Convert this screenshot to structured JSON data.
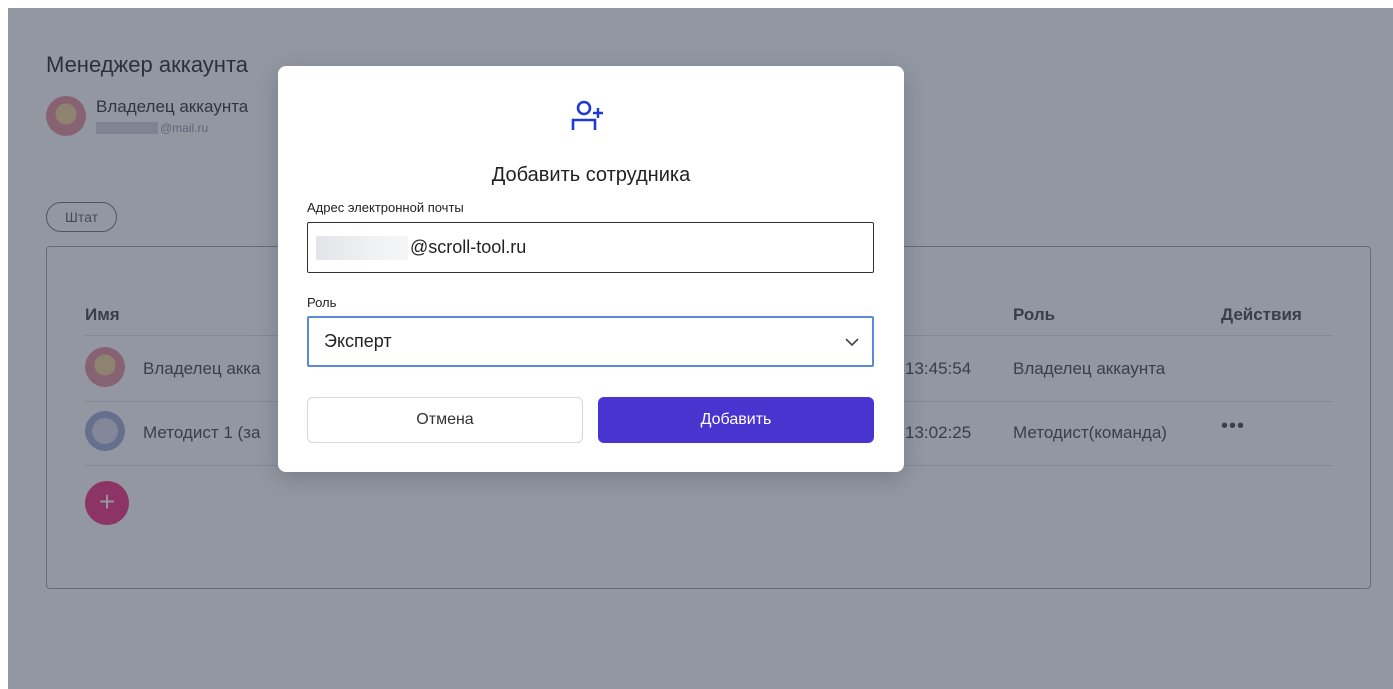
{
  "page": {
    "title": "Менеджер аккаунта",
    "owner_name": "Владелец аккаунта",
    "owner_email_suffix": "@mail.ru"
  },
  "staff_tab": {
    "label": "Штат"
  },
  "table": {
    "headers": {
      "name": "Имя",
      "role": "Роль",
      "actions": "Действия"
    },
    "rows": [
      {
        "name": "Владелец акка",
        "time": "13:45:54",
        "role": "Владелец аккаунта",
        "actions": ""
      },
      {
        "name": "Методист 1 (за",
        "time": "13:02:25",
        "role": "Методист(команда)",
        "actions": "•••"
      }
    ],
    "add_button": "+"
  },
  "modal": {
    "icon": "add-user-icon",
    "title": "Добавить сотрудника",
    "email_label": "Адрес электронной почты",
    "email_value": "@scroll-tool.ru",
    "role_label": "Роль",
    "role_value": "Эксперт",
    "cancel_label": "Отмена",
    "add_label": "Добавить"
  },
  "colors": {
    "accent": "#4a34d0",
    "focus_border": "#5b8bd6",
    "icon_blue": "#1e3ad6",
    "add_pink": "#f1428a"
  }
}
